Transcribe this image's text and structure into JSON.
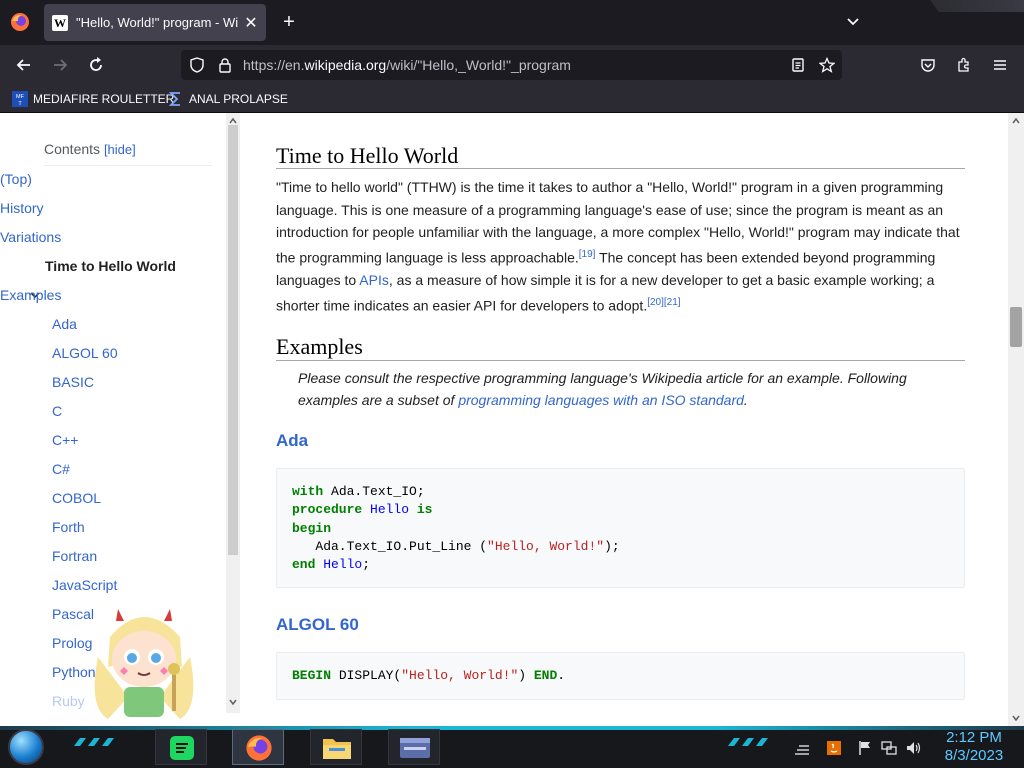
{
  "browser": {
    "tab_title": "\"Hello, World!\" program - Wikipedia",
    "tab_favicon": "W",
    "url_prefix": "https://en.",
    "url_domain": "wikipedia.org",
    "url_path": "/wiki/\"Hello,_World!\"_program"
  },
  "bookmarks": [
    {
      "label": "MEDIAFIRE ROULETTER"
    },
    {
      "label": "ANAL PROLAPSE"
    }
  ],
  "toc": {
    "title": "Contents",
    "hide_label": "[hide]",
    "items": [
      {
        "label": "(Top)"
      },
      {
        "label": "History"
      },
      {
        "label": "Variations"
      },
      {
        "label": "Time to Hello World"
      },
      {
        "label": "Examples"
      },
      {
        "label": "Ada"
      },
      {
        "label": "ALGOL 60"
      },
      {
        "label": "BASIC"
      },
      {
        "label": "C"
      },
      {
        "label": "C++"
      },
      {
        "label": "C#"
      },
      {
        "label": "COBOL"
      },
      {
        "label": "Forth"
      },
      {
        "label": "Fortran"
      },
      {
        "label": "JavaScript"
      },
      {
        "label": "Pascal"
      },
      {
        "label": "Prolog"
      },
      {
        "label": "Python"
      },
      {
        "label": "Ruby"
      }
    ]
  },
  "article": {
    "section1_title": "Time to Hello World",
    "para": {
      "t1": "\"Time to hello world\" (TTHW) is the time it takes to author a \"Hello, World!\" program in a given programming language. This is one measure of a programming language's ease of use; since the program is meant as an introduction for people unfamiliar with the language, a more complex \"Hello, World!\" program may indicate that the programming language is less approachable.",
      "ref1": "[19]",
      "t2": " The concept has been extended beyond programming languages to ",
      "link": "APIs",
      "t3": ", as a measure of how simple it is for a new developer to get a basic example working; a shorter time indicates an easier API for developers to adopt.",
      "ref2": "[20][21]"
    },
    "section2_title": "Examples",
    "hatnote": {
      "t1": "Please consult the respective programming language's Wikipedia article for an example. Following examples are a subset of ",
      "link": "programming languages with an ISO standard",
      "t2": "."
    },
    "ada": {
      "title": "Ada",
      "kw_with": "with",
      "l1_rest": " Ada.Text_IO;",
      "kw_procedure": "procedure",
      "l2_name": "Hello",
      "kw_is": "is",
      "kw_begin": "begin",
      "l4_pre": "   Ada.Text_IO.Put_Line (",
      "l4_str": "\"Hello, World!\"",
      "l4_post": ");",
      "kw_end": "end",
      "l5_name": "Hello",
      "l5_post": ";"
    },
    "algol": {
      "title": "ALGOL 60",
      "kw_begin": "BEGIN",
      "mid1": " DISPLAY(",
      "str": "\"Hello, World!\"",
      "mid2": ") ",
      "kw_end": "END",
      "post": "."
    }
  },
  "taskbar": {
    "time": "2:12 PM",
    "date": "8/3/2023"
  },
  "colors": {
    "link": "#3366cc",
    "clock": "#5ec8ff",
    "accent_strip": "#1bb6d6"
  }
}
